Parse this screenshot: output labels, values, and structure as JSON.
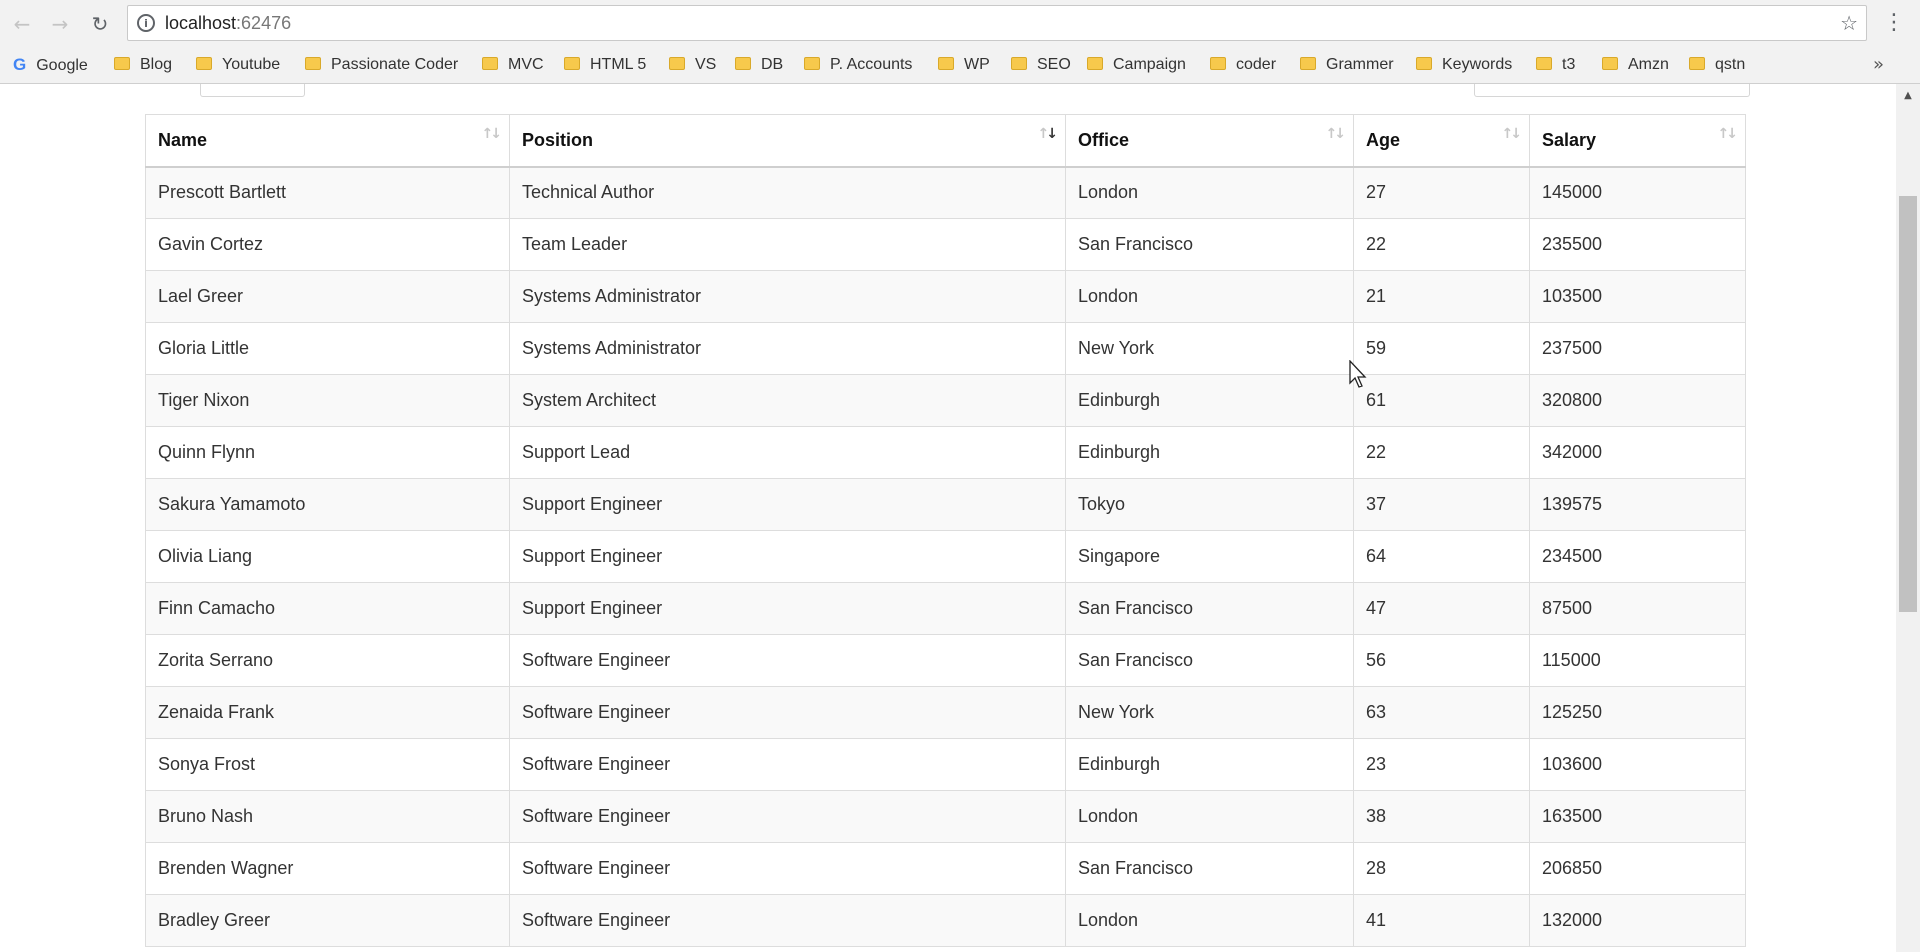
{
  "browser": {
    "back_icon": "←",
    "forward_icon": "→",
    "reload_icon": "↻",
    "info_icon": "i",
    "url_host": "localhost",
    "url_port": ":62476",
    "star_icon": "☆",
    "menu_icon": "⋮"
  },
  "bookmarks": {
    "items": [
      "Google",
      "Blog",
      "Youtube",
      "Passionate Coder",
      "MVC",
      "HTML 5",
      "VS",
      "DB",
      "P. Accounts",
      "WP",
      "SEO",
      "Campaign",
      "coder",
      "Grammer",
      "Keywords",
      "t3",
      "Amzn",
      "qstn"
    ],
    "google_glyph": "G",
    "overflow_icon": "»"
  },
  "table": {
    "headers": [
      "Name",
      "Position",
      "Office",
      "Age",
      "Salary"
    ],
    "sort_icon_up": "↑",
    "sort_icon_down": "↓",
    "rows": [
      [
        "Prescott Bartlett",
        "Technical Author",
        "London",
        "27",
        "145000"
      ],
      [
        "Gavin Cortez",
        "Team Leader",
        "San Francisco",
        "22",
        "235500"
      ],
      [
        "Lael Greer",
        "Systems Administrator",
        "London",
        "21",
        "103500"
      ],
      [
        "Gloria Little",
        "Systems Administrator",
        "New York",
        "59",
        "237500"
      ],
      [
        "Tiger Nixon",
        "System Architect",
        "Edinburgh",
        "61",
        "320800"
      ],
      [
        "Quinn Flynn",
        "Support Lead",
        "Edinburgh",
        "22",
        "342000"
      ],
      [
        "Sakura Yamamoto",
        "Support Engineer",
        "Tokyo",
        "37",
        "139575"
      ],
      [
        "Olivia Liang",
        "Support Engineer",
        "Singapore",
        "64",
        "234500"
      ],
      [
        "Finn Camacho",
        "Support Engineer",
        "San Francisco",
        "47",
        "87500"
      ],
      [
        "Zorita Serrano",
        "Software Engineer",
        "San Francisco",
        "56",
        "115000"
      ],
      [
        "Zenaida Frank",
        "Software Engineer",
        "New York",
        "63",
        "125250"
      ],
      [
        "Sonya Frost",
        "Software Engineer",
        "Edinburgh",
        "23",
        "103600"
      ],
      [
        "Bruno Nash",
        "Software Engineer",
        "London",
        "38",
        "163500"
      ],
      [
        "Brenden Wagner",
        "Software Engineer",
        "San Francisco",
        "28",
        "206850"
      ],
      [
        "Bradley Greer",
        "Software Engineer",
        "London",
        "41",
        "132000"
      ]
    ]
  },
  "scrollbar": {
    "up_icon": "▲"
  }
}
